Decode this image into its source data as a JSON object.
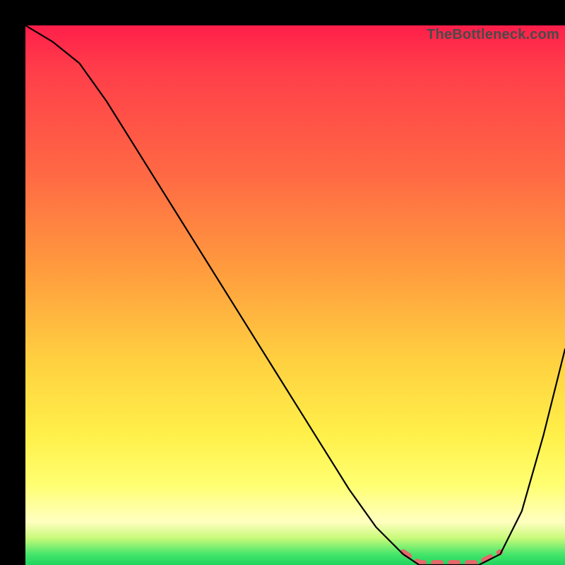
{
  "watermark": "TheBottleneck.com",
  "colors": {
    "frame": "#000000",
    "curve": "#000000",
    "valley_highlight": "#e36a6a",
    "gradient_stops": [
      "#ff1e4a",
      "#ff6a44",
      "#ffd040",
      "#ffff70",
      "#1fd45f"
    ]
  },
  "chart_data": {
    "type": "line",
    "title": "",
    "xlabel": "",
    "ylabel": "",
    "x": [
      0.0,
      0.05,
      0.1,
      0.15,
      0.2,
      0.25,
      0.3,
      0.35,
      0.4,
      0.45,
      0.5,
      0.55,
      0.6,
      0.65,
      0.7,
      0.73,
      0.76,
      0.8,
      0.84,
      0.88,
      0.92,
      0.96,
      1.0
    ],
    "values": [
      1.0,
      0.97,
      0.93,
      0.86,
      0.78,
      0.7,
      0.62,
      0.54,
      0.46,
      0.38,
      0.3,
      0.22,
      0.14,
      0.07,
      0.02,
      0.0,
      0.0,
      0.0,
      0.0,
      0.02,
      0.1,
      0.24,
      0.4
    ],
    "xlim": [
      0,
      1
    ],
    "ylim": [
      0,
      1
    ],
    "valley_range_x": [
      0.7,
      0.88
    ],
    "annotations": [],
    "grid": false,
    "legend": false
  }
}
